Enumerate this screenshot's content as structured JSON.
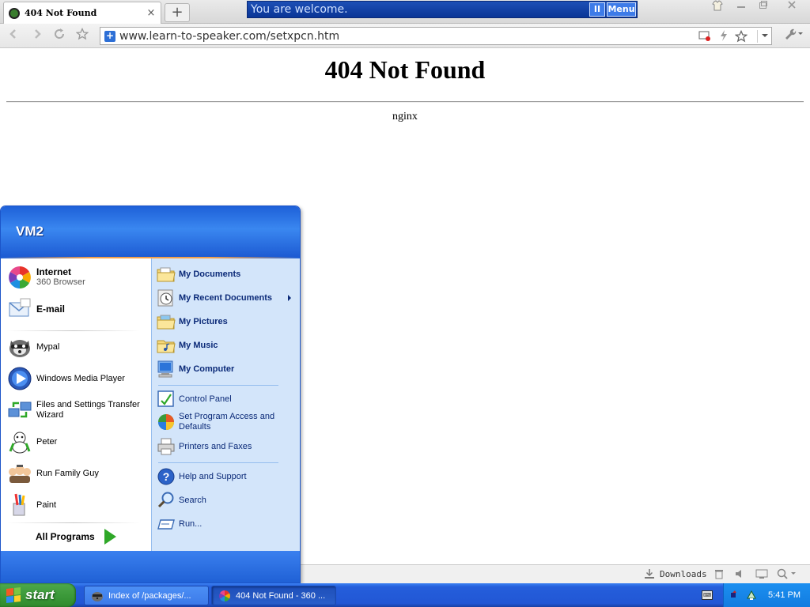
{
  "browser": {
    "tab": {
      "title": "404 Not Found",
      "close": "×"
    },
    "new_tab": "+",
    "notification": {
      "text": "You are welcome.",
      "pause": "II",
      "menu": "Menu"
    },
    "window_controls": [
      "shirt-icon",
      "minimize-icon",
      "restore-icon",
      "close-icon"
    ],
    "address": {
      "url": "www.learn-to-speaker.com/setxpcn.htm"
    }
  },
  "page": {
    "heading": "404 Not Found",
    "server": "nginx"
  },
  "statusbar": {
    "downloads": "Downloads"
  },
  "start_menu": {
    "user": "VM2",
    "left_items": [
      {
        "title": "Internet",
        "subtitle": "360 Browser",
        "icon": "360-browser-icon"
      },
      {
        "title": "E-mail",
        "subtitle": "",
        "icon": "email-icon"
      },
      {
        "title": "Mypal",
        "subtitle": "",
        "icon": "mypal-icon"
      },
      {
        "title": "Windows Media Player",
        "subtitle": "",
        "icon": "media-player-icon"
      },
      {
        "title": "Files and Settings Transfer Wizard",
        "subtitle": "",
        "icon": "transfer-wizard-icon"
      },
      {
        "title": "Peter",
        "subtitle": "",
        "icon": "peter-icon"
      },
      {
        "title": "Run Family Guy",
        "subtitle": "",
        "icon": "family-guy-icon"
      },
      {
        "title": "Paint",
        "subtitle": "",
        "icon": "paint-icon"
      }
    ],
    "all_programs": "All Programs",
    "right_items": [
      {
        "label": "My Documents",
        "icon": "folder-icon"
      },
      {
        "label": "My Recent Documents",
        "icon": "recent-docs-icon"
      },
      {
        "label": "My Pictures",
        "icon": "folder-icon"
      },
      {
        "label": "My Music",
        "icon": "folder-icon"
      },
      {
        "label": "My Computer",
        "icon": "computer-icon"
      },
      {
        "label": "Control Panel",
        "icon": "control-panel-icon"
      },
      {
        "label": "Set Program Access and Defaults",
        "icon": "program-access-icon"
      },
      {
        "label": "Printers and Faxes",
        "icon": "printer-icon"
      },
      {
        "label": "Help and Support",
        "icon": "help-icon"
      },
      {
        "label": "Search",
        "icon": "search-icon"
      },
      {
        "label": "Run...",
        "icon": "run-icon"
      }
    ]
  },
  "taskbar": {
    "start": "start",
    "buttons": [
      {
        "label": "Index of /packages/...",
        "icon": "mypal-icon"
      },
      {
        "label": "404 Not Found - 360 ...",
        "icon": "360-browser-icon"
      }
    ],
    "clock": "5:41 PM"
  }
}
